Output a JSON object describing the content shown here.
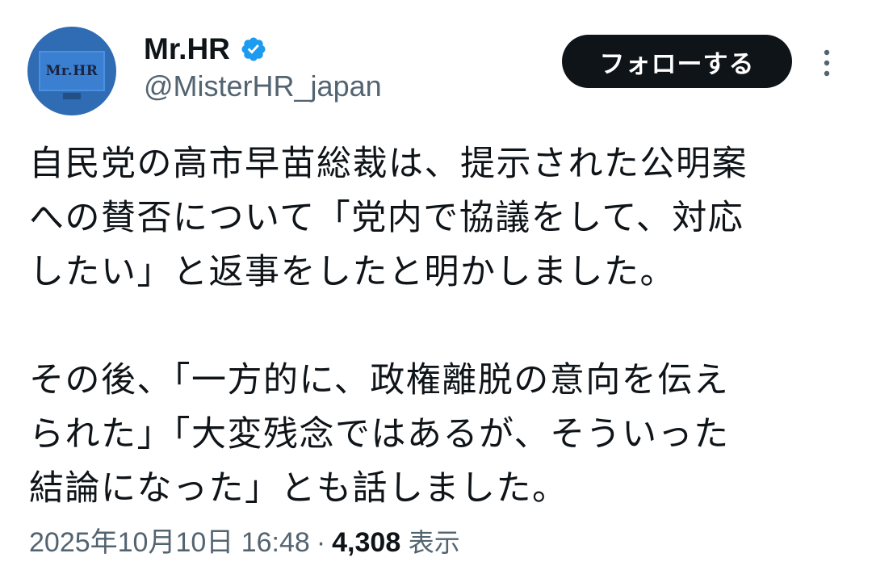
{
  "author": {
    "display_name": "Mr.HR",
    "handle": "@MisterHR_japan",
    "avatar_text": "Mr.HR",
    "verified": true
  },
  "follow_button": {
    "label": "フォローする"
  },
  "icons": {
    "verified": "verified-badge-icon",
    "more": "more-vertical-icon"
  },
  "tweet": {
    "paragraph_1": "自民党の高市早苗総裁は、提示された公明案\nへの賛否について「党内で協議をして、対応\nしたい」と返事をしたと明かしました。",
    "paragraph_2": "その後、「一方的に、政権離脱の意向を伝え\nられた」「大変残念ではあるが、そういった\n結論になった」とも話しました。"
  },
  "meta": {
    "timestamp": "2025年10月10日 16:48",
    "separator": "·",
    "views_count": "4,308",
    "views_label": "表示"
  },
  "colors": {
    "text_primary": "#0f1419",
    "text_secondary": "#536471",
    "verified_blue": "#1d9bf0",
    "button_bg": "#0f1419",
    "avatar_bg": "#2f6cb3"
  }
}
